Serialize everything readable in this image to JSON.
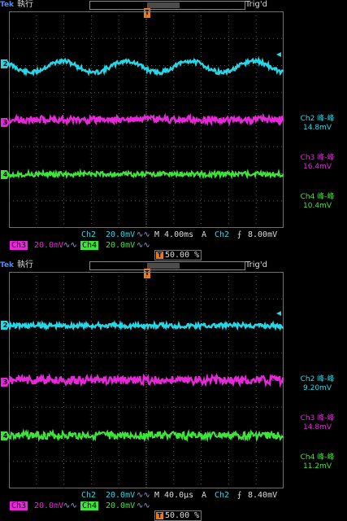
{
  "colors": {
    "ch2": "#25d8e8",
    "ch3": "#e628d9",
    "ch4": "#3ee43a",
    "trigger": "#f07a16",
    "grid": "#6f6f6f"
  },
  "icons": {
    "logo": "tek-logo",
    "trigger_position": "trigger-position-T-icon",
    "trigger_level": "trigger-level-arrow-icon",
    "bandwidth": "bandwidth-limit-icon",
    "slope": "rising-edge-icon"
  },
  "screens": [
    {
      "header": {
        "logo": "Tek",
        "run_state": "執行",
        "trig_state": "Trig'd"
      },
      "markers": {
        "ch2": "2",
        "ch3": "3",
        "ch4": "4",
        "trigger": "T"
      },
      "measurements": [
        {
          "label": "Ch2 峰-峰",
          "value": "14.8mV"
        },
        {
          "label": "Ch3 峰-峰",
          "value": "16.4mV"
        },
        {
          "label": "Ch4 峰-峰",
          "value": "10.4mV"
        }
      ],
      "status": {
        "ch2_name": "Ch2",
        "ch2_scale": "20.0mV",
        "timebase": "M 4.00ms",
        "trig_mode": "A",
        "trig_source": "Ch2",
        "trig_slope": "⨍",
        "trig_level": "8.00mV",
        "ch3_name": "Ch3",
        "ch3_scale": "20.0mV",
        "ch4_name": "Ch4",
        "ch4_scale": "20.0mV",
        "bw_glyph": "∿∿",
        "trig_offset_icon": "T",
        "trig_offset": "50.00 %"
      }
    },
    {
      "header": {
        "logo": "Tek",
        "run_state": "執行",
        "trig_state": "Trig'd"
      },
      "markers": {
        "ch2": "2",
        "ch3": "3",
        "ch4": "4",
        "trigger": "T"
      },
      "measurements": [
        {
          "label": "Ch2 峰-峰",
          "value": "9.20mV"
        },
        {
          "label": "Ch3 峰-峰",
          "value": "14.8mV"
        },
        {
          "label": "Ch4 峰-峰",
          "value": "11.2mV"
        }
      ],
      "status": {
        "ch2_name": "Ch2",
        "ch2_scale": "20.0mV",
        "timebase": "M 40.0µs",
        "trig_mode": "A",
        "trig_source": "Ch2",
        "trig_slope": "⨍",
        "trig_level": "8.40mV",
        "ch3_name": "Ch3",
        "ch3_scale": "20.0mV",
        "ch4_name": "Ch4",
        "ch4_scale": "20.0mV",
        "bw_glyph": "∿∿",
        "trig_offset_icon": "T",
        "trig_offset": "50.00 %"
      }
    }
  ]
}
